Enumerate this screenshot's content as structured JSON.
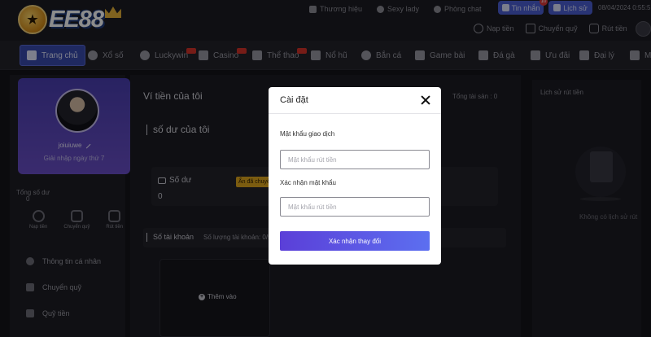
{
  "header": {
    "logo_text": "EE88",
    "links": [
      {
        "label": "Thương hiệu",
        "icon": "trophy-icon"
      },
      {
        "label": "Sexy lady",
        "icon": "play-icon"
      },
      {
        "label": "Phòng chat",
        "icon": "chat-icon"
      }
    ],
    "inbox_label": "Tin nhắn",
    "inbox_badge": "10",
    "history_label": "Lịch sử",
    "date": "08/04/2024 0:55:5",
    "quick_actions": [
      {
        "label": "Nạp tiền",
        "icon": "deposit-icon"
      },
      {
        "label": "Chuyển quỹ",
        "icon": "transfer-icon"
      },
      {
        "label": "Rút tiền",
        "icon": "withdraw-icon"
      }
    ]
  },
  "nav": {
    "items": [
      {
        "label": "Trang chủ",
        "icon": "home-icon",
        "active": true
      },
      {
        "label": "Xổ số",
        "icon": "lottery-icon"
      },
      {
        "label": "Luckywin",
        "icon": "luckywin-icon",
        "hot": true
      },
      {
        "label": "Casino",
        "icon": "casino-icon",
        "hot": true
      },
      {
        "label": "Thể thao",
        "icon": "sports-icon",
        "hot": true
      },
      {
        "label": "Nổ hũ",
        "icon": "slots-icon"
      },
      {
        "label": "Bắn cá",
        "icon": "fishing-icon"
      },
      {
        "label": "Game bài",
        "icon": "cards-icon"
      },
      {
        "label": "Đá gà",
        "icon": "cockfight-icon"
      },
      {
        "label": "Ưu đãi",
        "icon": "promo-icon"
      },
      {
        "label": "Đại lý",
        "icon": "agent-icon"
      },
      {
        "label": "Me",
        "icon": "more-icon"
      }
    ]
  },
  "sidebar": {
    "username": "joiuiuwe",
    "login_days": "Giải nhập ngày thứ 7",
    "total_label": "Tổng số dư",
    "total_value": "0",
    "actions": [
      {
        "label": "Nạp tiền",
        "icon": "deposit-icon"
      },
      {
        "label": "Chuyển quỹ",
        "icon": "transfer-icon"
      },
      {
        "label": "Rút tiền",
        "icon": "withdraw-icon"
      }
    ],
    "menu": [
      {
        "label": "Thông tin cá nhân",
        "icon": "user-icon"
      },
      {
        "label": "Chuyển quỹ",
        "icon": "transfer-icon"
      },
      {
        "label": "Quỹ tiền",
        "icon": "fund-icon"
      }
    ]
  },
  "main": {
    "wallet_title": "Ví tiền của tôi",
    "total_balance": "Tổng tài sản : 0",
    "section_title": "số dư của tôi",
    "balance_label": "Số dư",
    "balance_value": "0",
    "hide_tag": "Ẩn đã chuyển",
    "account_title": "Số tài khoản",
    "account_count": "Số lượng tài khoản: 0/5",
    "add_label": "Thêm vào"
  },
  "right": {
    "title": "Lịch sử rút tiền",
    "empty_text": "Không có lịch sử rút"
  },
  "modal": {
    "title": "Cài đặt",
    "password_label": "Mật khẩu giao dịch",
    "password_placeholder": "Mật khẩu rút tiền",
    "confirm_label": "Xác nhận mật khẩu",
    "confirm_placeholder": "Mật khẩu rút tiền",
    "submit_label": "Xác nhận thay đổi"
  },
  "colors": {
    "accent": "#4c5fd5",
    "gold": "#e0a81e",
    "background": "#15151b"
  }
}
